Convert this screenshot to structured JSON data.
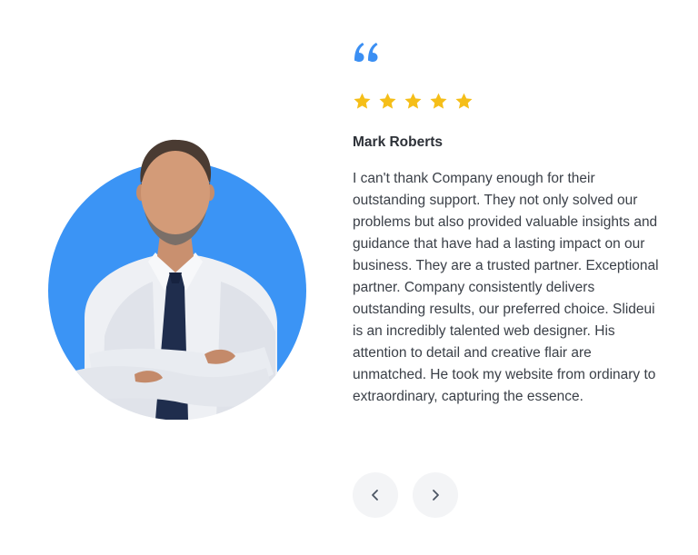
{
  "testimonial": {
    "quote_icon": "quote-icon",
    "rating": 5,
    "rating_max": 5,
    "star_icon": "star-icon",
    "star_color": "#F5BE18",
    "author_name": "Mark Roberts",
    "text": "I can't thank Company enough for their outstanding support. They not only solved our problems but also provided valuable insights and guidance that have had a lasting impact on our business. They are a trusted partner. Exceptional partner. Company consistently delivers outstanding results, our preferred choice. Slideui is an incredibly talented web designer. His attention to detail and creative flair are unmatched. He took my website from ordinary to extraordinary, capturing the essence."
  },
  "portrait": {
    "image": "portrait of smiling man in white shirt and navy tie",
    "backdrop_color": "#3B94F5"
  },
  "navigation": {
    "prev_icon": "chevron-left-icon",
    "next_icon": "chevron-right-icon"
  },
  "colors": {
    "accent": "#3B8FF3",
    "button_bg": "#F3F4F6",
    "text": "#3B4048"
  }
}
